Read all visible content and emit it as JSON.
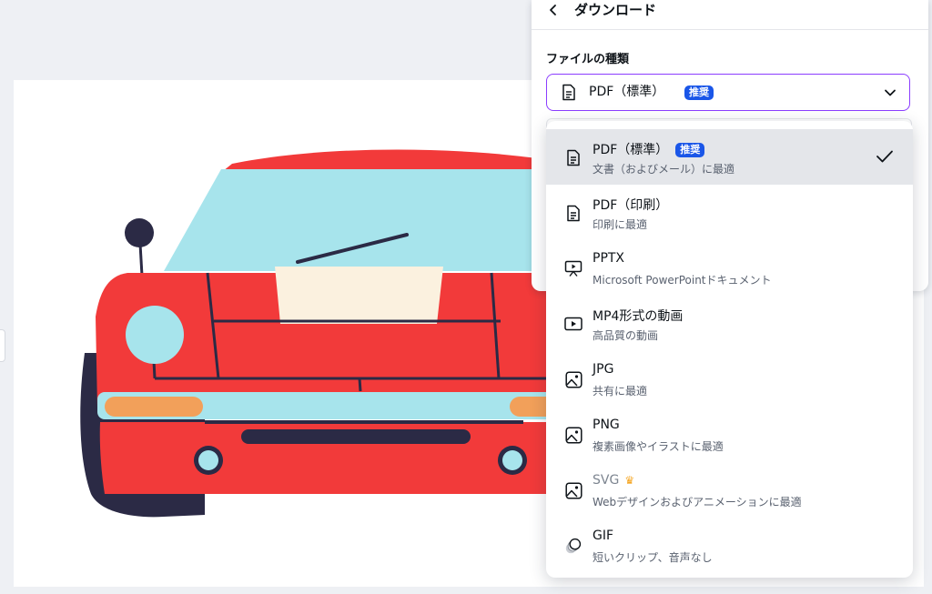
{
  "panel": {
    "title": "ダウンロード",
    "file_type_label": "ファイルの種類",
    "selected_value": "PDF（標準）",
    "selected_badge": "推奨"
  },
  "options": [
    {
      "label": "PDF（標準）",
      "badge": "推奨",
      "desc": "文書（およびメール）に最適",
      "icon": "document-icon",
      "selected": true
    },
    {
      "label": "PDF（印刷）",
      "desc": "印刷に最適",
      "icon": "document-icon"
    },
    {
      "label": "PPTX",
      "desc": "Microsoft PowerPointドキュメント",
      "icon": "presentation-icon"
    },
    {
      "label": "MP4形式の動画",
      "desc": "高品質の動画",
      "icon": "video-icon"
    },
    {
      "label": "JPG",
      "desc": "共有に最適",
      "icon": "image-icon"
    },
    {
      "label": "PNG",
      "desc": "複素画像やイラストに最適",
      "icon": "image-icon"
    },
    {
      "label": "SVG",
      "desc": "Webデザインおよびアニメーションに最適",
      "icon": "image-icon",
      "premium": true
    },
    {
      "label": "GIF",
      "desc": "短いクリップ、音声なし",
      "icon": "gif-icon"
    }
  ],
  "colors": {
    "accent": "#8b3dff",
    "badge": "#1a56e8",
    "selected_bg": "#e4e6ea",
    "car_body": "#f23a3a",
    "windshield": "#a7e4ec",
    "tire": "#2b2a45",
    "headlight": "#a7e4ec",
    "turn_signal": "#f2a05a"
  }
}
